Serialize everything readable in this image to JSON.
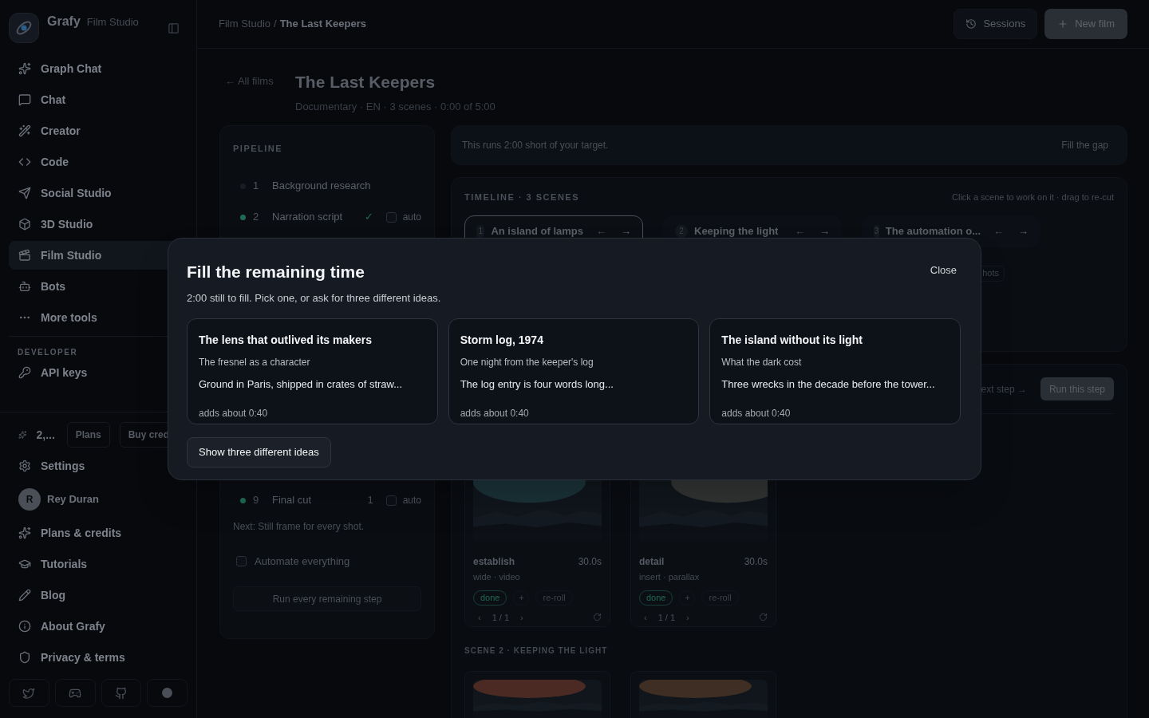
{
  "sidebar": {
    "brand": "Grafy",
    "brand_sub": "Film Studio",
    "items": [
      {
        "label": "Graph Chat",
        "selected": false
      },
      {
        "label": "Chat",
        "selected": false
      },
      {
        "label": "Creator",
        "selected": false
      },
      {
        "label": "Code",
        "selected": false
      },
      {
        "label": "Social Studio",
        "selected": false
      },
      {
        "label": "3D Studio",
        "selected": false
      },
      {
        "label": "Film Studio",
        "selected": true
      },
      {
        "label": "Bots",
        "selected": false
      },
      {
        "label": "More tools",
        "selected": false
      }
    ],
    "developer_heading": "DEVELOPER",
    "developer_items": [
      {
        "label": "API keys",
        "selected": false
      }
    ],
    "credits": "2,...",
    "plans_button": "Plans",
    "buy_button": "Buy cred",
    "settings": "Settings",
    "user": {
      "initial": "R",
      "name": "Rey Duran"
    },
    "links": [
      "Plans & credits",
      "Tutorials",
      "Blog",
      "About Grafy",
      "Privacy & terms"
    ]
  },
  "header": {
    "breadcrumb_parent": "Film Studio",
    "breadcrumb_separator": "/",
    "breadcrumb_current": "The Last Keepers",
    "sessions_button": "Sessions",
    "new_button": "New film"
  },
  "page": {
    "back_link": "← All films",
    "title": "The Last Keepers",
    "meta": "Documentary · EN · 3 scenes · 0:00 of 5:00"
  },
  "pipeline": {
    "heading": "PIPELINE",
    "steps": [
      {
        "number": "1",
        "label": "Background research",
        "done": false
      },
      {
        "number": "2",
        "label": "Narration script",
        "done": true,
        "tick": "✓",
        "auto_label": "auto",
        "auto": false
      },
      {
        "number": "9",
        "label": "Final cut",
        "done": true,
        "count": "1",
        "auto_label": "auto",
        "auto": false
      }
    ],
    "next_text": "Next: Still frame for every shot.",
    "automate": {
      "label": "Automate everything",
      "checked": false
    },
    "run_all": "Run every remaining step"
  },
  "banner": {
    "text": "This runs 2:00 short of your target.",
    "action": "Fill the gap"
  },
  "timeline": {
    "heading": "TIMELINE · 3 SCENES",
    "hint": "Click a scene to work on it · drag to re-cut",
    "scenes": [
      {
        "number": "1",
        "title": "An island of lamps",
        "selected": true,
        "left": "←",
        "right": "→"
      },
      {
        "number": "2",
        "title": "Keeping the light",
        "selected": false,
        "left": "←",
        "right": "→"
      },
      {
        "number": "3",
        "title": "The automation o...",
        "selected": false,
        "left": "←",
        "right": "→"
      }
    ],
    "chip_fragment": "hots"
  },
  "step_panel": {
    "next_fragment": "ext step →",
    "run_button": "Run this step",
    "shots": [
      {
        "name": "establish",
        "duration": "30.0s",
        "meta": "wide · video",
        "status": "done",
        "add": "+",
        "reroll": "re-roll",
        "prev": "‹",
        "pager": "1 / 1",
        "next": "›"
      },
      {
        "name": "detail",
        "duration": "30.0s",
        "meta": "insert · parallax",
        "status": "done",
        "add": "+",
        "reroll": "re-roll",
        "prev": "‹",
        "pager": "1 / 1",
        "next": "›"
      }
    ],
    "scene2_heading": "SCENE 2 · KEEPING THE LIGHT"
  },
  "modal": {
    "title": "Fill the remaining time",
    "subtitle": "2:00 still to fill. Pick one, or ask for three different ideas.",
    "close": "Close",
    "ideas": [
      {
        "title": "The lens that outlived its makers",
        "subtitle": "The fresnel as a character",
        "body": "Ground in Paris, shipped in crates of straw...",
        "duration": "adds about 0:40"
      },
      {
        "title": "Storm log, 1974",
        "subtitle": "One night from the keeper's log",
        "body": "The log entry is four words long...",
        "duration": "adds about 0:40"
      },
      {
        "title": "The island without its light",
        "subtitle": "What the dark cost",
        "body": "Three wrecks in the decade before the tower...",
        "duration": "adds about 0:40"
      }
    ],
    "more_button": "Show three different ideas"
  }
}
